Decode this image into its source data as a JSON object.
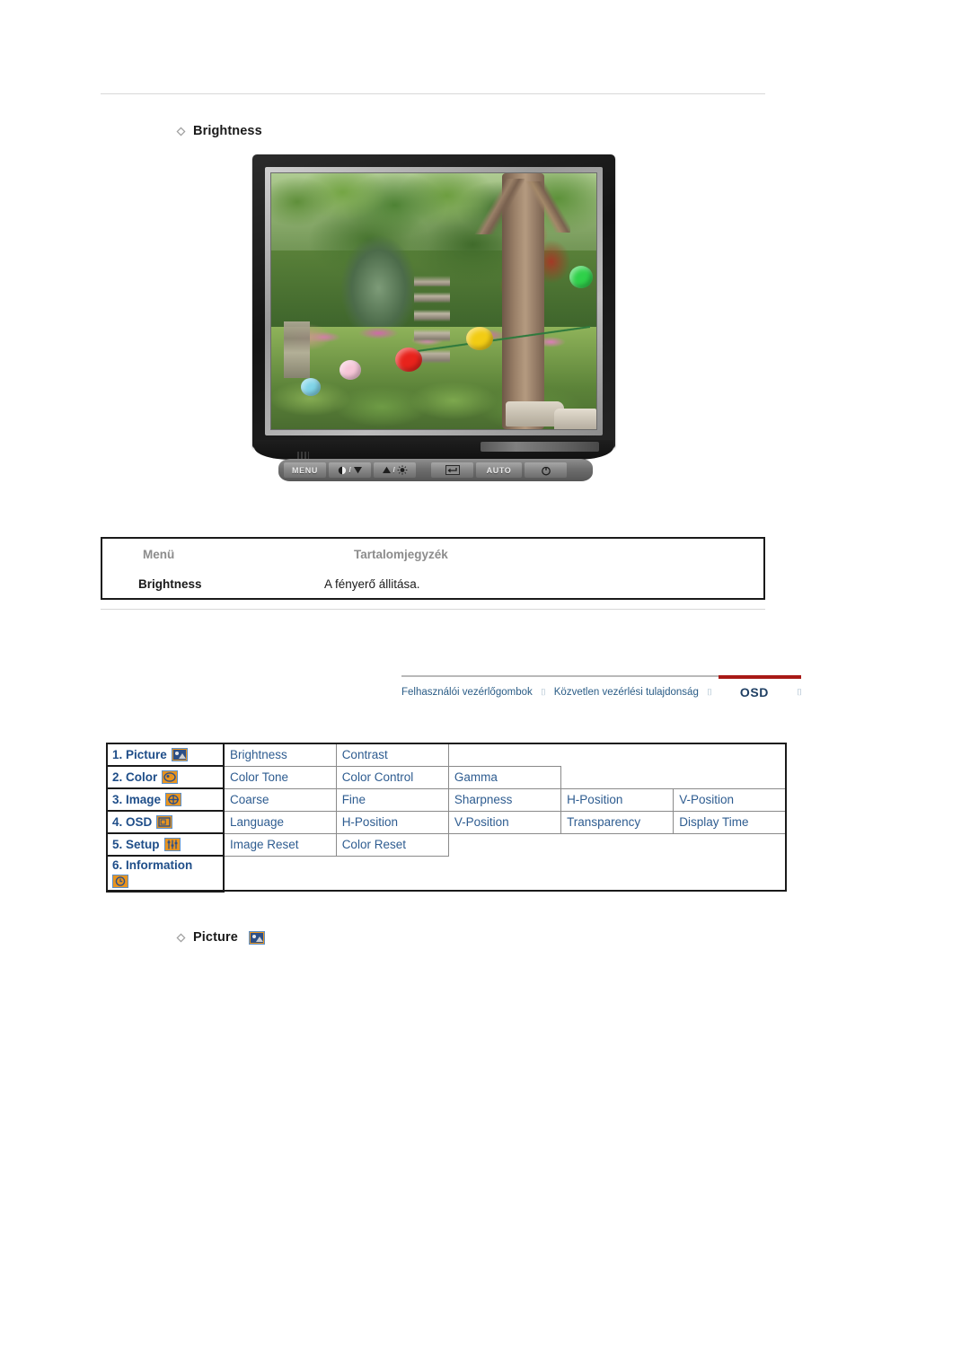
{
  "page": {
    "heading_brightness": "Brightness",
    "heading_picture": "Picture"
  },
  "monitor": {
    "controls": [
      {
        "name": "menu-button",
        "label": "MENU"
      },
      {
        "name": "brightness-down-button",
        "label": ""
      },
      {
        "name": "brightness-up-button",
        "label": ""
      },
      {
        "name": "enter-button",
        "label": ""
      },
      {
        "name": "auto-button",
        "label": "AUTO"
      },
      {
        "name": "power-button",
        "label": ""
      }
    ],
    "menu_label": "MENU",
    "auto_label": "AUTO"
  },
  "menu_table": {
    "header": {
      "col1": "Menü",
      "col2": "Tartalomjegyzék"
    },
    "rows": [
      {
        "menu": "Brightness",
        "description": "A fényerő állitása."
      }
    ]
  },
  "tabs": {
    "items": [
      {
        "label": "Felhasználói vezérlőgombok",
        "active": false
      },
      {
        "label": "Közvetlen vezérlési tulajdonság",
        "active": false
      },
      {
        "label": "OSD",
        "active": true
      }
    ],
    "separator": "⌷",
    "accent_color": "#a81916",
    "link_color": "#2a5c86"
  },
  "osd_table": {
    "rows": [
      {
        "category": "1. Picture",
        "icon": "picture-icon",
        "items": [
          "Brightness",
          "Contrast"
        ]
      },
      {
        "category": "2. Color",
        "icon": "color-icon",
        "items": [
          "Color Tone",
          "Color Control",
          "Gamma"
        ]
      },
      {
        "category": "3. Image",
        "icon": "image-icon",
        "items": [
          "Coarse",
          "Fine",
          "Sharpness",
          "H-Position",
          "V-Position"
        ]
      },
      {
        "category": "4. OSD",
        "icon": "osd-icon",
        "items": [
          "Language",
          "H-Position",
          "V-Position",
          "Transparency",
          "Display Time"
        ]
      },
      {
        "category": "5. Setup",
        "icon": "setup-icon",
        "items": [
          "Image Reset",
          "Color Reset"
        ]
      },
      {
        "category": "6. Information",
        "icon": "information-icon",
        "items": []
      }
    ]
  },
  "colors": {
    "osd_text": "#2e5c90",
    "osd_category": "#1f4e89",
    "icon_fill": "#e8941f",
    "icon_border": "#5b8fc9",
    "rule": "#d8d8d8"
  }
}
